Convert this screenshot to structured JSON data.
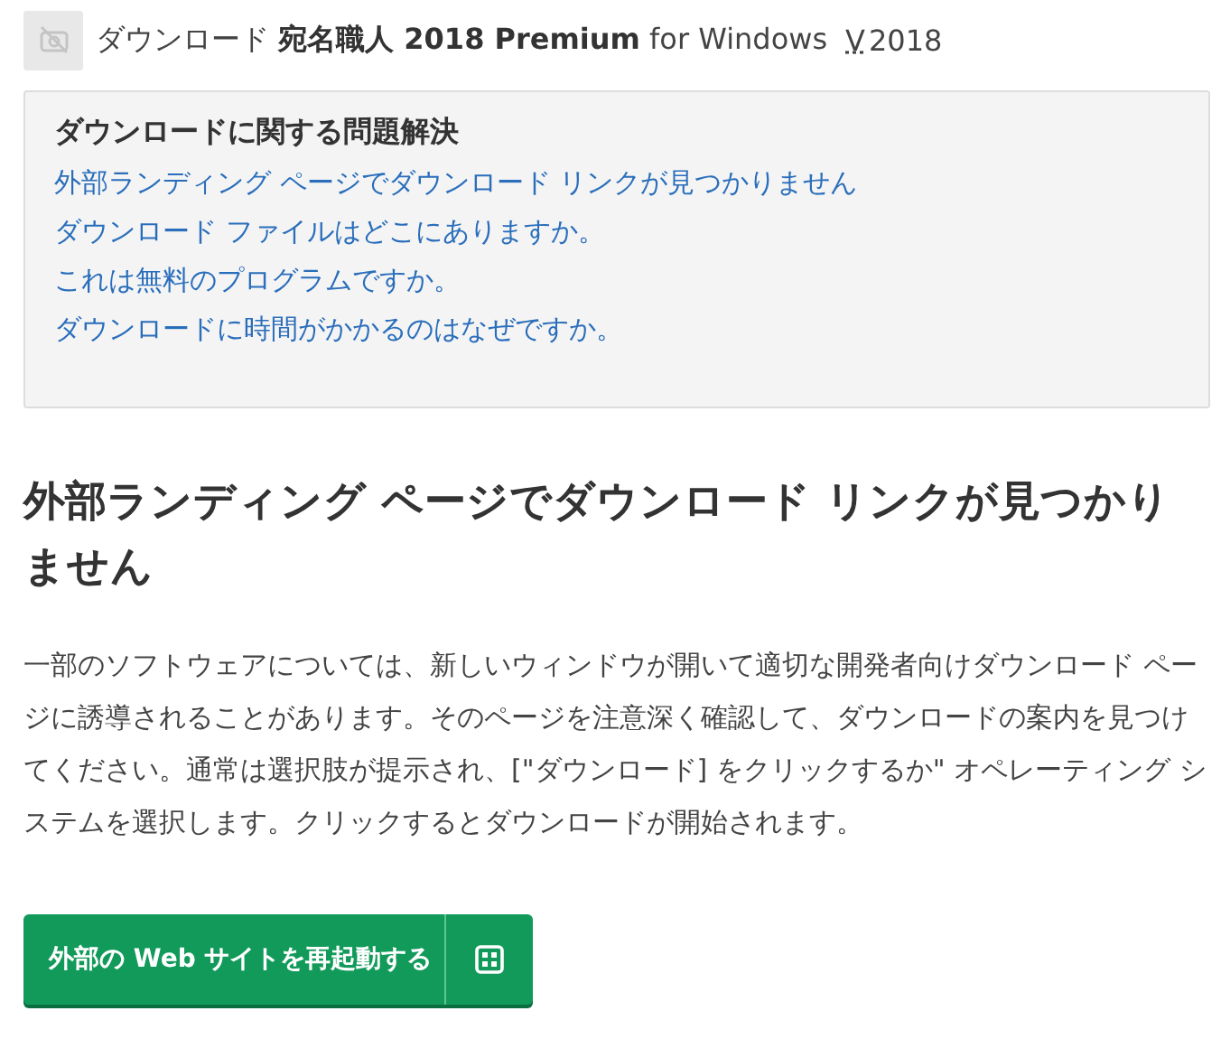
{
  "header": {
    "title": "ダウンロード **宛名職人 2018 Premium** for Windows",
    "version_prefix": "V",
    "version": "2018"
  },
  "help_box": {
    "title": "ダウンロードに関する問題解決",
    "links": [
      "外部ランディング ページでダウンロード リンクが見つかりません",
      "ダウンロード ファイルはどこにありますか。",
      "これは無料のプログラムですか。",
      "ダウンロードに時間がかかるのはなぜですか。"
    ]
  },
  "section": {
    "heading": "外部ランディング ページでダウンロード リンクが見つかりません",
    "body": "一部のソフトウェアについては、新しいウィンドウが開いて適切な開発者向けダウンロード ページに誘導されることがあります。そのページを注意深く確認して、ダウンロードの案内を見つけてください。通常は選択肢が提示され、[\"ダウンロード] をクリックするか\" オペレーティング システムを選択します。クリックするとダウンロードが開始されます。"
  },
  "button": {
    "label": "外部の Web サイトを再起動する"
  }
}
